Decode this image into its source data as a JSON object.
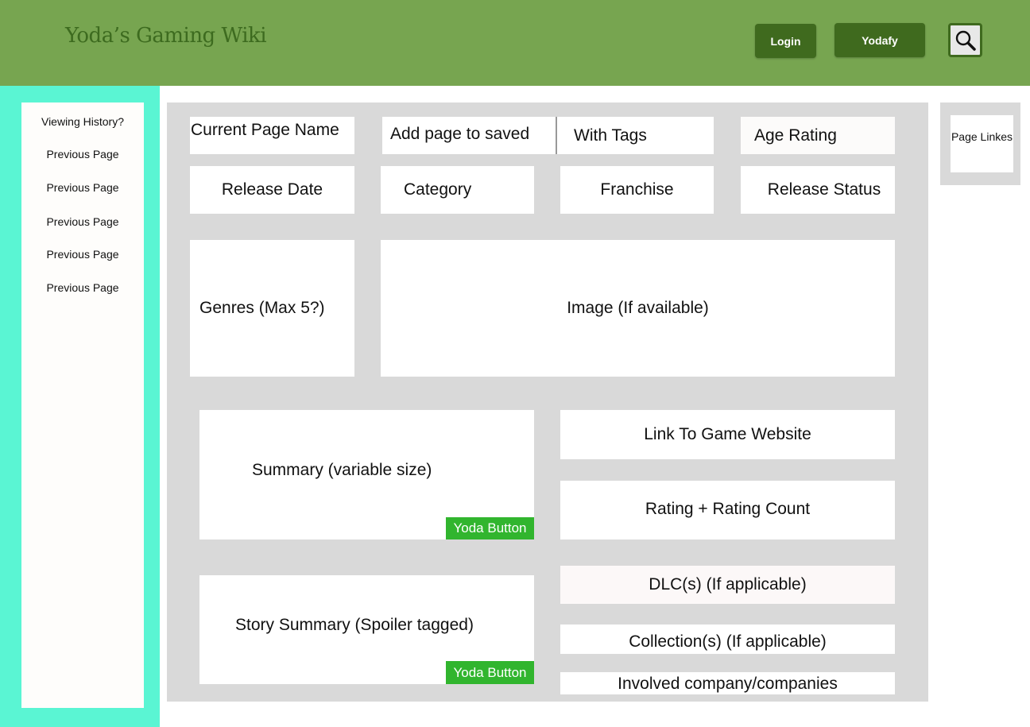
{
  "header": {
    "site_title": "Yoda’s Gaming Wiki",
    "login_label": "Login",
    "yodafy_label": "Yodafy",
    "search_icon": "search-icon"
  },
  "sidebar": {
    "heading": "Viewing History?",
    "items": [
      "Previous Page",
      "Previous Page",
      "Previous Page",
      "Previous Page",
      "Previous Page"
    ]
  },
  "main": {
    "current_page_name": "Current Page Name",
    "add_to_saved": "Add page to saved",
    "with_tags": "With Tags",
    "age_rating": "Age Rating",
    "release_date": "Release Date",
    "category": "Category",
    "franchise": "Franchise",
    "release_status": "Release Status",
    "genres": "Genres (Max 5?)",
    "image": "Image (If available)",
    "summary": "Summary (variable size)",
    "summary_yoda_button": "Yoda Button",
    "link_to_website": "Link To Game Website",
    "rating": "Rating + Rating Count",
    "dlc": "DLC(s) (If applicable)",
    "story_summary": "Story Summary (Spoiler tagged)",
    "story_yoda_button": "Yoda Button",
    "collections": "Collection(s) (If applicable)",
    "companies": "Involved company/companies"
  },
  "right_panel": {
    "page_links": "Page Linkes"
  },
  "colors": {
    "header": "#77a550",
    "button": "#3f6a1e",
    "sidebar": "#5af5d3",
    "content_bg": "#d9d9d9",
    "yoda_button": "#31b52e"
  }
}
